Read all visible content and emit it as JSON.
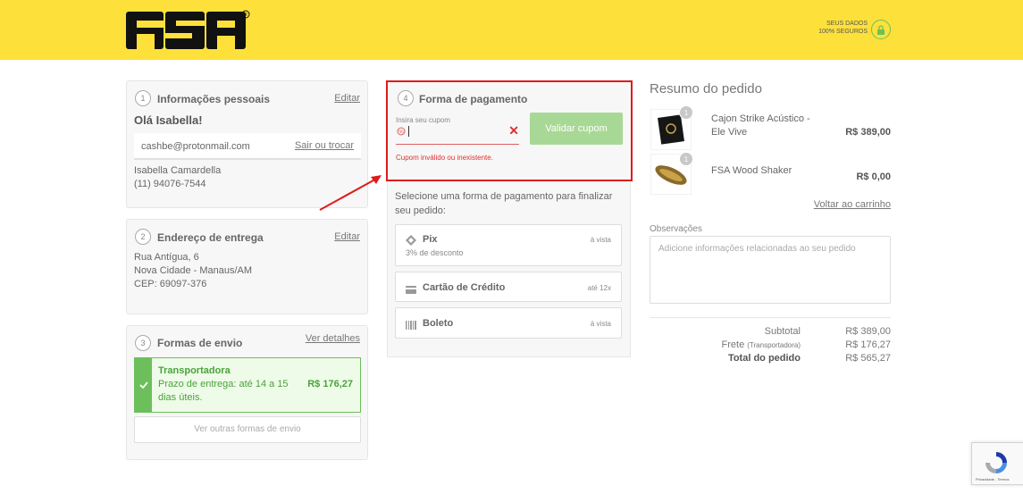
{
  "header": {
    "logo_text": "FSA",
    "secure_line1": "SEUS DADOS",
    "secure_line2": "100% SEGUROS",
    "brand_color": "#fde13a"
  },
  "personal": {
    "step": "1",
    "title": "Informações pessoais",
    "edit": "Editar",
    "greeting": "Olá Isabella!",
    "email": "cashbe@protonmail.com",
    "switch": "Sair ou trocar",
    "name": "Isabella Camardella",
    "phone": "(11) 94076-7544"
  },
  "address": {
    "step": "2",
    "title": "Endereço de entrega",
    "edit": "Editar",
    "line1": "Rua Antígua, 6",
    "line2": "Nova Cidade - Manaus/AM",
    "line3": "CEP: 69097-376"
  },
  "shipping": {
    "step": "3",
    "title": "Formas de envio",
    "details": "Ver detalhes",
    "selected_name": "Transportadora",
    "selected_desc": "Prazo de entrega: até 14 a 15 dias úteis.",
    "selected_price": "R$ 176,27",
    "other": "Ver outras formas de envio"
  },
  "payment": {
    "step": "4",
    "title": "Forma de pagamento",
    "coupon_label": "Insira seu cupom",
    "coupon_button": "Validar cupom",
    "coupon_error": "Cupom inválido ou inexistente.",
    "instructions": "Selecione uma forma de pagamento para finalizar seu pedido:",
    "options": [
      {
        "name": "Pix",
        "note": "à vista",
        "sub": "3% de desconto",
        "icon": "pix-icon"
      },
      {
        "name": "Cartão de Crédito",
        "note": "até 12x",
        "icon": "credit-card-icon"
      },
      {
        "name": "Boleto",
        "note": "à vista",
        "icon": "barcode-icon"
      }
    ]
  },
  "summary": {
    "title": "Resumo do pedido",
    "items": [
      {
        "qty": "1",
        "name": "Cajon Strike Acústico - Ele Vive",
        "price": "R$ 389,00"
      },
      {
        "qty": "1",
        "name": "FSA Wood Shaker",
        "price": "R$ 0,00"
      }
    ],
    "back_to_cart": "Voltar ao carrinho",
    "notes_label": "Observações",
    "notes_placeholder": "Adicione informações relacionadas ao seu pedido",
    "subtotal_label": "Subtotal",
    "subtotal": "R$ 389,00",
    "freight_label": "Frete",
    "freight_sub": "(Transportadora)",
    "freight": "R$ 176,27",
    "total_label": "Total do pedido",
    "total": "R$ 565,27"
  },
  "recaptcha": {
    "footer": "Privacidade - Termos"
  }
}
